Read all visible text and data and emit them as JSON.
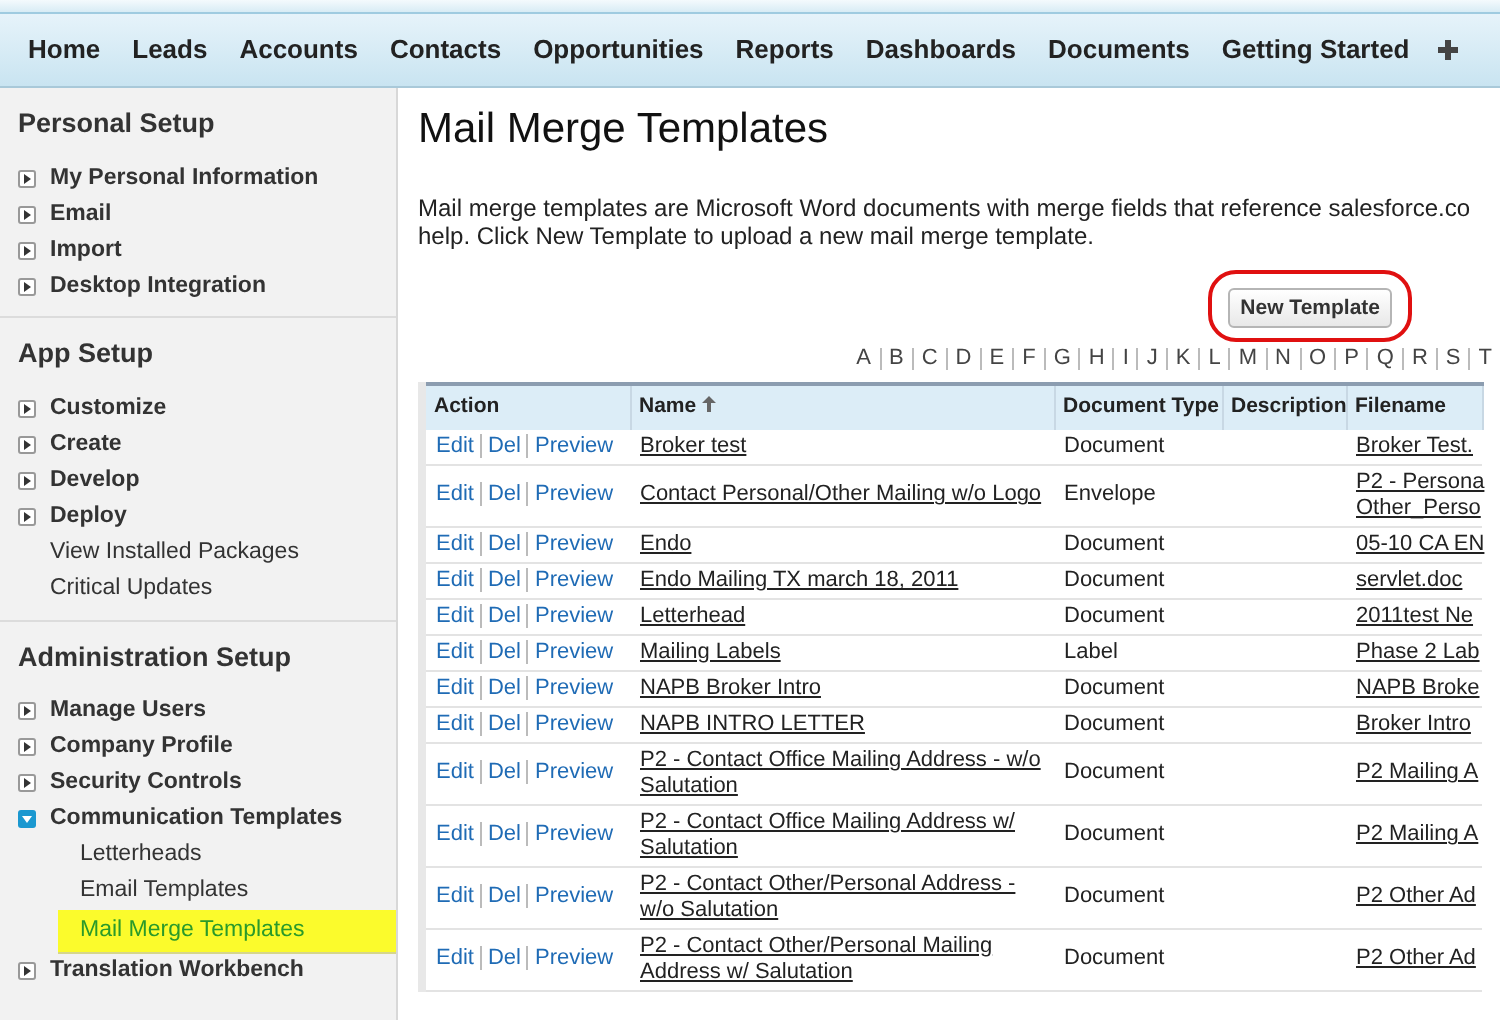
{
  "nav_tabs": [
    {
      "label": "Home"
    },
    {
      "label": "Leads"
    },
    {
      "label": "Accounts"
    },
    {
      "label": "Contacts"
    },
    {
      "label": "Opportunities"
    },
    {
      "label": "Reports"
    },
    {
      "label": "Dashboards"
    },
    {
      "label": "Documents"
    },
    {
      "label": "Getting Started"
    }
  ],
  "sidebar": {
    "sections": [
      {
        "title": "Personal Setup",
        "items": [
          {
            "label": "My Personal Information",
            "kind": "expandable",
            "expanded": false
          },
          {
            "label": "Email",
            "kind": "expandable",
            "expanded": false
          },
          {
            "label": "Import",
            "kind": "expandable",
            "expanded": false
          },
          {
            "label": "Desktop Integration",
            "kind": "expandable",
            "expanded": false
          }
        ]
      },
      {
        "title": "App Setup",
        "items": [
          {
            "label": "Customize",
            "kind": "expandable",
            "expanded": false
          },
          {
            "label": "Create",
            "kind": "expandable",
            "expanded": false
          },
          {
            "label": "Develop",
            "kind": "expandable",
            "expanded": false
          },
          {
            "label": "Deploy",
            "kind": "expandable",
            "expanded": false
          },
          {
            "label": "View Installed Packages",
            "kind": "link"
          },
          {
            "label": "Critical Updates",
            "kind": "link"
          }
        ]
      },
      {
        "title": "Administration Setup",
        "items": [
          {
            "label": "Manage Users",
            "kind": "expandable",
            "expanded": false
          },
          {
            "label": "Company Profile",
            "kind": "expandable",
            "expanded": false
          },
          {
            "label": "Security Controls",
            "kind": "expandable",
            "expanded": false
          },
          {
            "label": "Communication Templates",
            "kind": "expandable",
            "expanded": true,
            "children": [
              {
                "label": "Letterheads",
                "selected": false
              },
              {
                "label": "Email Templates",
                "selected": false
              },
              {
                "label": "Mail Merge Templates",
                "selected": true
              }
            ]
          },
          {
            "label": "Translation Workbench",
            "kind": "expandable",
            "expanded": false
          }
        ]
      }
    ]
  },
  "page": {
    "title": "Mail Merge Templates",
    "description": "Mail merge templates are Microsoft Word documents with merge fields that reference salesforce.co help. Click New Template to upload a new mail merge template.",
    "new_button": "New Template",
    "alphabet": [
      "A",
      "B",
      "C",
      "D",
      "E",
      "F",
      "G",
      "H",
      "I",
      "J",
      "K",
      "L",
      "M",
      "N",
      "O",
      "P",
      "Q",
      "R",
      "S",
      "T"
    ]
  },
  "table": {
    "columns": [
      "Action",
      "Name",
      "Document Type",
      "Description",
      "Filename"
    ],
    "rows": [
      {
        "actions": [
          "Edit",
          "Del",
          "Preview"
        ],
        "name": "Broker test",
        "document_type": "Document",
        "filename": "Broker Test."
      },
      {
        "actions": [
          "Edit",
          "Del",
          "Preview"
        ],
        "name": "Contact Personal/Other Mailing w/o Logo",
        "document_type": "Envelope",
        "filename": "P2 - Persona\nOther_Perso"
      },
      {
        "actions": [
          "Edit",
          "Del",
          "Preview"
        ],
        "name": "Endo",
        "document_type": "Document",
        "filename": "05-10 CA EN"
      },
      {
        "actions": [
          "Edit",
          "Del",
          "Preview"
        ],
        "name": "Endo Mailing TX march 18, 2011",
        "document_type": "Document",
        "filename": "servlet.doc"
      },
      {
        "actions": [
          "Edit",
          "Del",
          "Preview"
        ],
        "name": "Letterhead",
        "document_type": "Document",
        "filename": "2011test Ne"
      },
      {
        "actions": [
          "Edit",
          "Del",
          "Preview"
        ],
        "name": "Mailing Labels",
        "document_type": "Label",
        "filename": "Phase 2 Lab"
      },
      {
        "actions": [
          "Edit",
          "Del",
          "Preview"
        ],
        "name": "NAPB Broker Intro",
        "document_type": "Document",
        "filename": "NAPB Broke"
      },
      {
        "actions": [
          "Edit",
          "Del",
          "Preview"
        ],
        "name": "NAPB INTRO LETTER",
        "document_type": "Document",
        "filename": "Broker Intro"
      },
      {
        "actions": [
          "Edit",
          "Del",
          "Preview"
        ],
        "name": "P2 - Contact Office Mailing Address - w/o Salutation",
        "document_type": "Document",
        "filename": "P2 Mailing A"
      },
      {
        "actions": [
          "Edit",
          "Del",
          "Preview"
        ],
        "name": "P2 - Contact Office Mailing Address w/ Salutation",
        "document_type": "Document",
        "filename": "P2 Mailing A"
      },
      {
        "actions": [
          "Edit",
          "Del",
          "Preview"
        ],
        "name": "P2 - Contact Other/Personal Address - w/o Salutation",
        "document_type": "Document",
        "filename": "P2 Other Ad"
      },
      {
        "actions": [
          "Edit",
          "Del",
          "Preview"
        ],
        "name": "P2 - Contact Other/Personal Mailing Address w/ Salutation",
        "document_type": "Document",
        "filename": "P2 Other Ad"
      }
    ]
  }
}
